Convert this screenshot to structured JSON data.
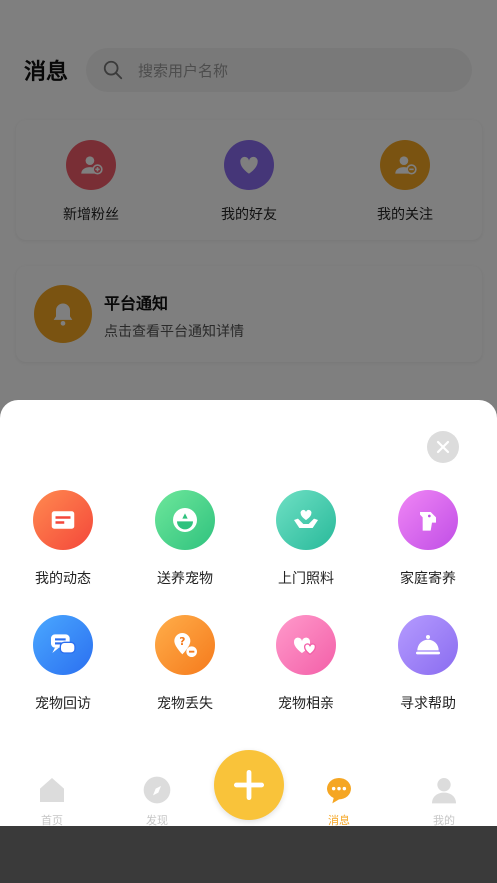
{
  "header": {
    "title": "消息",
    "search_placeholder": "搜索用户名称"
  },
  "quick_actions": [
    {
      "label": "新增粉丝",
      "icon": "add-user-icon",
      "color": "#f35d6a"
    },
    {
      "label": "我的好友",
      "icon": "heart-icon",
      "color": "#8b6cf0"
    },
    {
      "label": "我的关注",
      "icon": "user-minus-icon",
      "color": "#f5a623"
    }
  ],
  "notice": {
    "title": "平台通知",
    "subtitle": "点击查看平台通知详情",
    "icon": "bell-icon",
    "color": "#f5a623"
  },
  "sheet": {
    "items": [
      {
        "label": "我的动态",
        "icon": "card-icon"
      },
      {
        "label": "送养宠物",
        "icon": "bowl-icon"
      },
      {
        "label": "上门照料",
        "icon": "hand-heart-icon"
      },
      {
        "label": "家庭寄养",
        "icon": "dog-icon"
      },
      {
        "label": "宠物回访",
        "icon": "chat-icon"
      },
      {
        "label": "宠物丢失",
        "icon": "lost-icon"
      },
      {
        "label": "宠物相亲",
        "icon": "hearts-icon"
      },
      {
        "label": "寻求帮助",
        "icon": "cloche-icon"
      }
    ]
  },
  "tabs": [
    {
      "label": "首页",
      "icon": "home-icon"
    },
    {
      "label": "发现",
      "icon": "compass-icon"
    },
    {
      "label": "消息",
      "icon": "message-icon",
      "active": true
    },
    {
      "label": "我的",
      "icon": "user-icon"
    }
  ],
  "colors": {
    "accent": "#f5a623",
    "fab": "#f9c33a"
  }
}
